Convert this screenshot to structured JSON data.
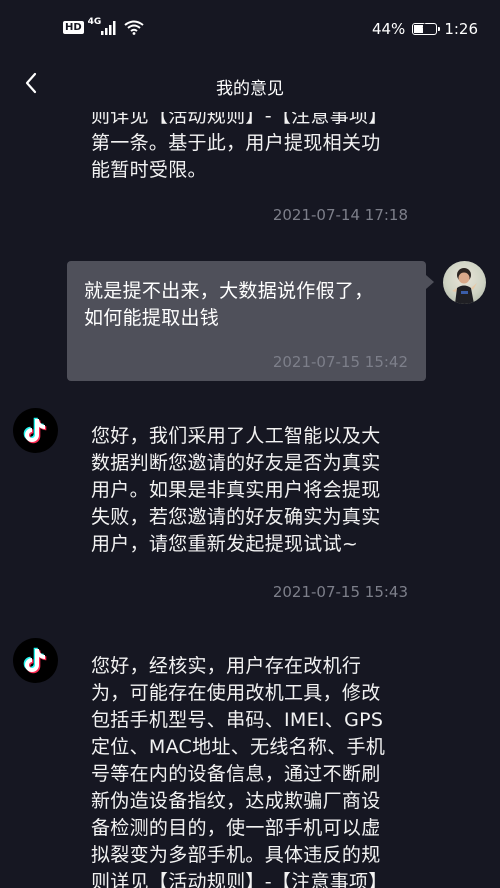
{
  "status_bar": {
    "hd": "HD",
    "network": "4G",
    "battery_percent": "44%",
    "battery_level": 0.44,
    "time": "1:26"
  },
  "nav": {
    "title": "我的意见",
    "back_icon": "chevron-left-icon"
  },
  "messages": [
    {
      "sender": "app",
      "text": "则详见【活动规则】-【注意事项】\n第一条。基于此，用户提现相关功\n能暂时受限。",
      "time": "2021-07-14 17:18"
    },
    {
      "sender": "user",
      "text": "就是提不出来，大数据说作假了，\n如何能提取出钱",
      "time": "2021-07-15 15:42"
    },
    {
      "sender": "app",
      "text": "您好，我们采用了人工智能以及大\n数据判断您邀请的好友是否为真实\n用户。如果是非真实用户将会提现\n失败，若您邀请的好友确实为真实\n用户，请您重新发起提现试试~",
      "time": "2021-07-15 15:43"
    },
    {
      "sender": "app",
      "text": "您好，经核实，用户存在改机行\n为，可能存在使用改机工具，修改\n包括手机型号、串码、IMEI、GPS\n定位、MAC地址、无线名称、手机\n号等在内的设备信息，通过不断刷\n新伪造设备指纹，达成欺骗厂商设\n备检测的目的，使一部手机可以虚\n拟裂变为多部手机。具体违反的规\n则详见【活动规则】-【注意事项】",
      "time": ""
    }
  ],
  "colors": {
    "background": "#161722",
    "user_bubble": "#4f505a",
    "timestamp": "#7d7f8a",
    "tiktok_cyan": "#25f4ee",
    "tiktok_red": "#fe2c55"
  }
}
